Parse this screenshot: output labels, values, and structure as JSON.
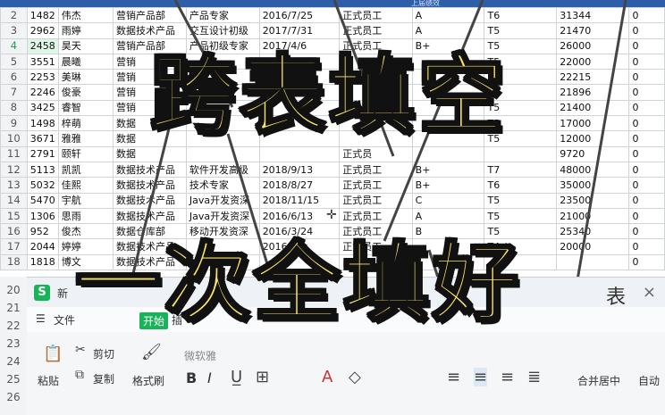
{
  "sheet": {
    "header_partial": "上届绩效",
    "rows": [
      {
        "num": "2",
        "cells": [
          "1482",
          "伟杰",
          "营销产品部",
          "产品专家",
          "2016/7/25",
          "正式员工",
          "A",
          "T6",
          "31344",
          "0"
        ]
      },
      {
        "num": "3",
        "cells": [
          "2962",
          "雨婷",
          "数据技术产品",
          "交互设计初级",
          "2017/7/31",
          "正式员工",
          "A",
          "T5",
          "21470",
          "0"
        ]
      },
      {
        "num": "4",
        "cells": [
          "2458",
          "昊天",
          "营销产品部",
          "产品初级专家",
          "2017/4/6",
          "正式员工",
          "B+",
          "T5",
          "26000",
          "0"
        ]
      },
      {
        "num": "5",
        "cells": [
          "3551",
          "晨曦",
          "营销",
          "",
          "",
          "",
          "",
          "T5",
          "22000",
          "0"
        ]
      },
      {
        "num": "6",
        "cells": [
          "2253",
          "美琳",
          "营销",
          "",
          "",
          "",
          "",
          "T5",
          "22215",
          "0"
        ]
      },
      {
        "num": "7",
        "cells": [
          "2246",
          "俊豪",
          "营销",
          "",
          "",
          "",
          "",
          "T5",
          "21896",
          "0"
        ]
      },
      {
        "num": "8",
        "cells": [
          "3425",
          "睿智",
          "营销",
          "",
          "",
          "",
          "",
          "T5",
          "21400",
          "0"
        ]
      },
      {
        "num": "9",
        "cells": [
          "1498",
          "梓萌",
          "数据",
          "",
          "",
          "",
          "",
          "T5",
          "17000",
          "0"
        ]
      },
      {
        "num": "10",
        "cells": [
          "3671",
          "雅雅",
          "数据",
          "",
          "",
          "",
          "",
          "T5",
          "12000",
          "0"
        ]
      },
      {
        "num": "11",
        "cells": [
          "2791",
          "颐轩",
          "数据",
          "",
          "",
          "正式员",
          "",
          "",
          "9720",
          "0"
        ]
      },
      {
        "num": "12",
        "cells": [
          "5113",
          "凯凯",
          "数据技术产品",
          "软件开发高级",
          "2018/9/13",
          "正式员工",
          "B+",
          "T7",
          "48000",
          "0"
        ]
      },
      {
        "num": "13",
        "cells": [
          "5032",
          "佳熙",
          "数据技术产品",
          "技术专家",
          "2018/8/27",
          "正式员工",
          "B+",
          "T6",
          "35000",
          "0"
        ]
      },
      {
        "num": "14",
        "cells": [
          "5470",
          "宇航",
          "数据技术产品",
          "Java开发资深",
          "2018/11/15",
          "正式员工",
          "C",
          "T5",
          "23500",
          "0"
        ]
      },
      {
        "num": "15",
        "cells": [
          "1306",
          "思雨",
          "数据技术产品",
          "Java开发资深",
          "2016/6/13",
          "正式员工",
          "A",
          "T5",
          "21000",
          "0"
        ]
      },
      {
        "num": "16",
        "cells": [
          "952",
          "俊杰",
          "数据仓库部",
          "移动开发资深",
          "2016/3/24",
          "正式员工",
          "B",
          "T5",
          "25340",
          "0"
        ]
      },
      {
        "num": "17",
        "cells": [
          "2044",
          "婷婷",
          "数据技术产品",
          "",
          "2016/3/2",
          "正式员工",
          "",
          "T4",
          "20000",
          "0"
        ]
      },
      {
        "num": "18",
        "cells": [
          "1818",
          "博文",
          "数据技术产品",
          "",
          "",
          "",
          "",
          "",
          "",
          "0"
        ]
      }
    ]
  },
  "overlay": {
    "line1": "跨表填空",
    "line2": "一次全填好"
  },
  "app": {
    "logo": "S",
    "title": "新",
    "right_text": "表",
    "close": "×"
  },
  "menu": {
    "file": "文件",
    "start": "开始",
    "insert": "插"
  },
  "ribbon": {
    "paste": "粘贴",
    "cut": "剪切",
    "copy": "复制",
    "format_painter": "格式刷",
    "font": "微软雅",
    "bold": "B",
    "italic": "I",
    "merge": "合并居中",
    "auto": "自动"
  },
  "zoom_rows": [
    "20",
    "21",
    "22",
    "23",
    "24",
    "25",
    "26"
  ],
  "colors": {
    "accent": "#19b35a",
    "header": "#2f5ea8",
    "overlay_fill": "#f8e36a"
  }
}
